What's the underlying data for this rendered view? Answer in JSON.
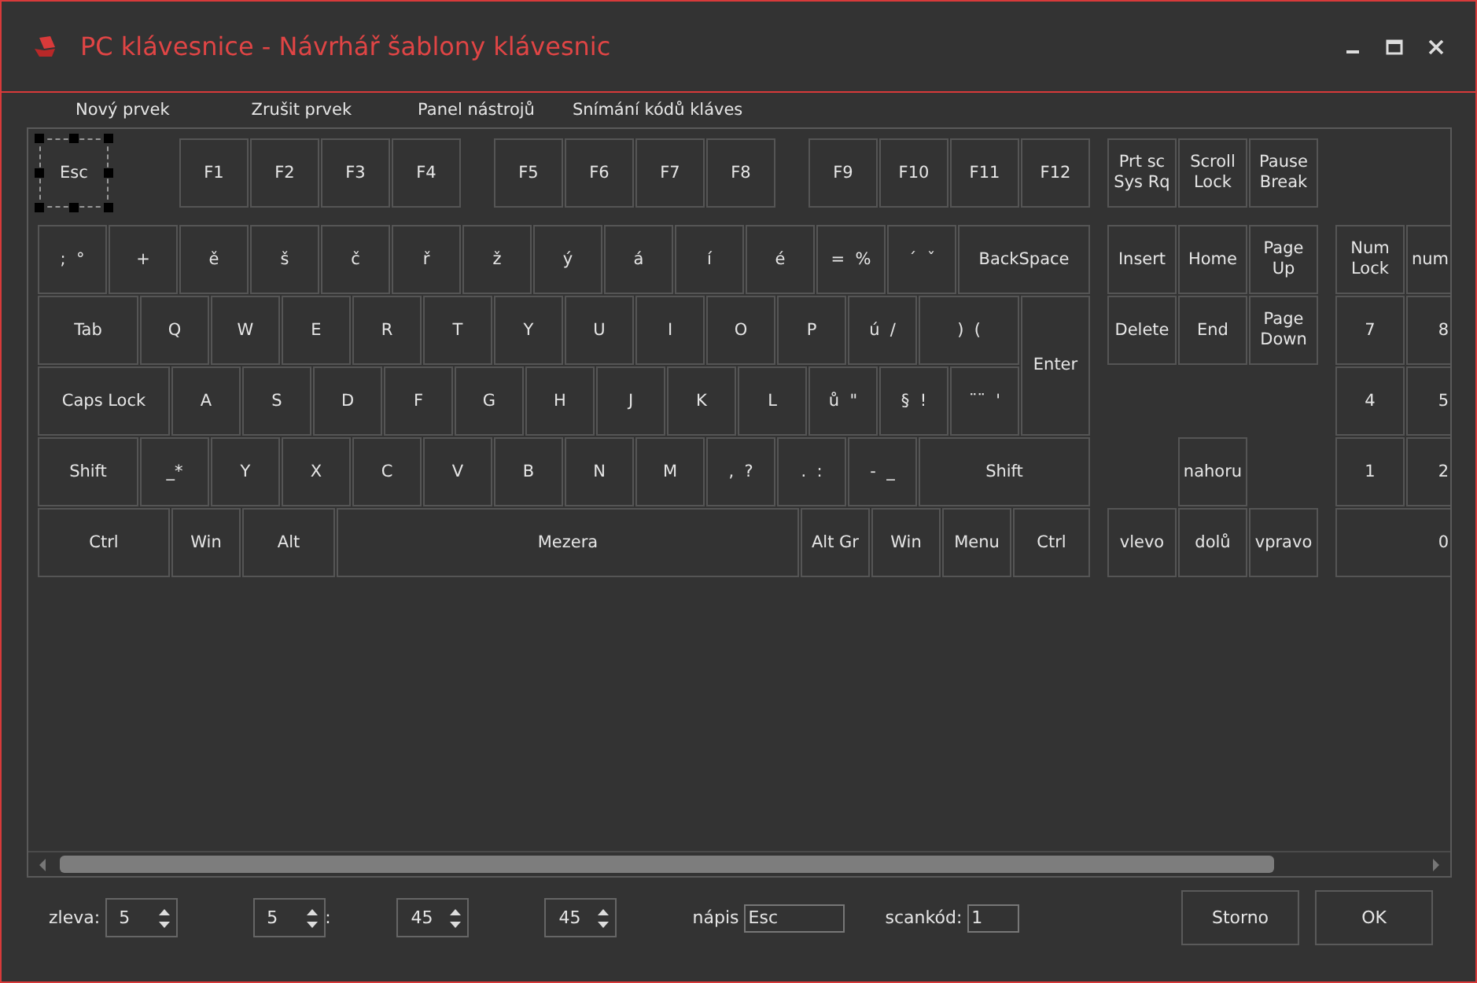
{
  "window": {
    "title": "PC klávesnice - Návrhář šablony klávesnic"
  },
  "menu": [
    "Nový prvek",
    "Zrušit prvek",
    "Panel nástrojů",
    "Snímání kódů kláves"
  ],
  "keys": [
    {
      "label": "Esc",
      "selected": true
    },
    {
      "label": "F1",
      "selected": false
    },
    {
      "label": "F2",
      "selected": false
    },
    {
      "label": "F3",
      "selected": false
    },
    {
      "label": "F4",
      "selected": false
    },
    {
      "label": "F5",
      "selected": false
    },
    {
      "label": "F6",
      "selected": false
    },
    {
      "label": "F7",
      "selected": false
    },
    {
      "label": "F8",
      "selected": false
    },
    {
      "label": "F9",
      "selected": false
    },
    {
      "label": "F10",
      "selected": false
    },
    {
      "label": "F11",
      "selected": false
    },
    {
      "label": "F12",
      "selected": false
    },
    {
      "label": "Prt sc\nSys Rq",
      "selected": false
    },
    {
      "label": "Scroll\nLock",
      "selected": false
    },
    {
      "label": "Pause\nBreak",
      "selected": false
    },
    {
      "label": ";  °",
      "selected": false
    },
    {
      "label": "+",
      "selected": false
    },
    {
      "label": "ě",
      "selected": false
    },
    {
      "label": "š",
      "selected": false
    },
    {
      "label": "č",
      "selected": false
    },
    {
      "label": "ř",
      "selected": false
    },
    {
      "label": "ž",
      "selected": false
    },
    {
      "label": "ý",
      "selected": false
    },
    {
      "label": "á",
      "selected": false
    },
    {
      "label": "í",
      "selected": false
    },
    {
      "label": "é",
      "selected": false
    },
    {
      "label": "=  %",
      "selected": false
    },
    {
      "label": "´  ˇ",
      "selected": false
    },
    {
      "label": "BackSpace",
      "selected": false
    },
    {
      "label": "Tab",
      "selected": false
    },
    {
      "label": "Q",
      "selected": false
    },
    {
      "label": "W",
      "selected": false
    },
    {
      "label": "E",
      "selected": false
    },
    {
      "label": "R",
      "selected": false
    },
    {
      "label": "T",
      "selected": false
    },
    {
      "label": "Y",
      "selected": false
    },
    {
      "label": "U",
      "selected": false
    },
    {
      "label": "I",
      "selected": false
    },
    {
      "label": "O",
      "selected": false
    },
    {
      "label": "P",
      "selected": false
    },
    {
      "label": "ú  /",
      "selected": false
    },
    {
      "label": ")  (",
      "selected": false
    },
    {
      "label": "Enter",
      "selected": false
    },
    {
      "label": "Caps Lock",
      "selected": false
    },
    {
      "label": "A",
      "selected": false
    },
    {
      "label": "S",
      "selected": false
    },
    {
      "label": "D",
      "selected": false
    },
    {
      "label": "F",
      "selected": false
    },
    {
      "label": "G",
      "selected": false
    },
    {
      "label": "H",
      "selected": false
    },
    {
      "label": "J",
      "selected": false
    },
    {
      "label": "K",
      "selected": false
    },
    {
      "label": "L",
      "selected": false
    },
    {
      "label": "ů  \"",
      "selected": false
    },
    {
      "label": "§  !",
      "selected": false
    },
    {
      "label": "¨¨  '",
      "selected": false
    },
    {
      "label": "Shift",
      "selected": false
    },
    {
      "label": "_*",
      "selected": false
    },
    {
      "label": "Y",
      "selected": false
    },
    {
      "label": "X",
      "selected": false
    },
    {
      "label": "C",
      "selected": false
    },
    {
      "label": "V",
      "selected": false
    },
    {
      "label": "B",
      "selected": false
    },
    {
      "label": "N",
      "selected": false
    },
    {
      "label": "M",
      "selected": false
    },
    {
      "label": ",  ?",
      "selected": false
    },
    {
      "label": ".  :",
      "selected": false
    },
    {
      "label": "-  _",
      "selected": false
    },
    {
      "label": "Shift",
      "selected": false
    },
    {
      "label": "Ctrl",
      "selected": false
    },
    {
      "label": "Win",
      "selected": false
    },
    {
      "label": "Alt",
      "selected": false
    },
    {
      "label": "Mezera",
      "selected": false
    },
    {
      "label": "Alt Gr",
      "selected": false
    },
    {
      "label": "Win",
      "selected": false
    },
    {
      "label": "Menu",
      "selected": false
    },
    {
      "label": "Ctrl",
      "selected": false
    },
    {
      "label": "Insert",
      "selected": false
    },
    {
      "label": "Home",
      "selected": false
    },
    {
      "label": "Page\nUp",
      "selected": false
    },
    {
      "label": "Delete",
      "selected": false
    },
    {
      "label": "End",
      "selected": false
    },
    {
      "label": "Page\nDown",
      "selected": false
    },
    {
      "label": "nahoru",
      "selected": false
    },
    {
      "label": "vlevo",
      "selected": false
    },
    {
      "label": "dolů",
      "selected": false
    },
    {
      "label": "vpravo",
      "selected": false
    },
    {
      "label": "Num\nLock",
      "selected": false
    },
    {
      "label": "num",
      "selected": false
    },
    {
      "label": "7",
      "selected": false
    },
    {
      "label": "8",
      "selected": false
    },
    {
      "label": "4",
      "selected": false
    },
    {
      "label": "5",
      "selected": false
    },
    {
      "label": "1",
      "selected": false
    },
    {
      "label": "2",
      "selected": false
    },
    {
      "label": "0",
      "selected": false
    }
  ],
  "properties": [
    {
      "kind": "spin",
      "label": "zleva:",
      "value": "5"
    },
    {
      "kind": "spin",
      "value": "5"
    },
    {
      "kind": "label",
      "label": ":"
    },
    {
      "kind": "spin",
      "value": "45"
    },
    {
      "kind": "spin",
      "value": "45"
    },
    {
      "kind": "text",
      "label": "nápis",
      "value": "Esc"
    },
    {
      "kind": "text",
      "label": "scankód:",
      "value": "1"
    }
  ],
  "buttons": [
    "Storno",
    "OK"
  ]
}
